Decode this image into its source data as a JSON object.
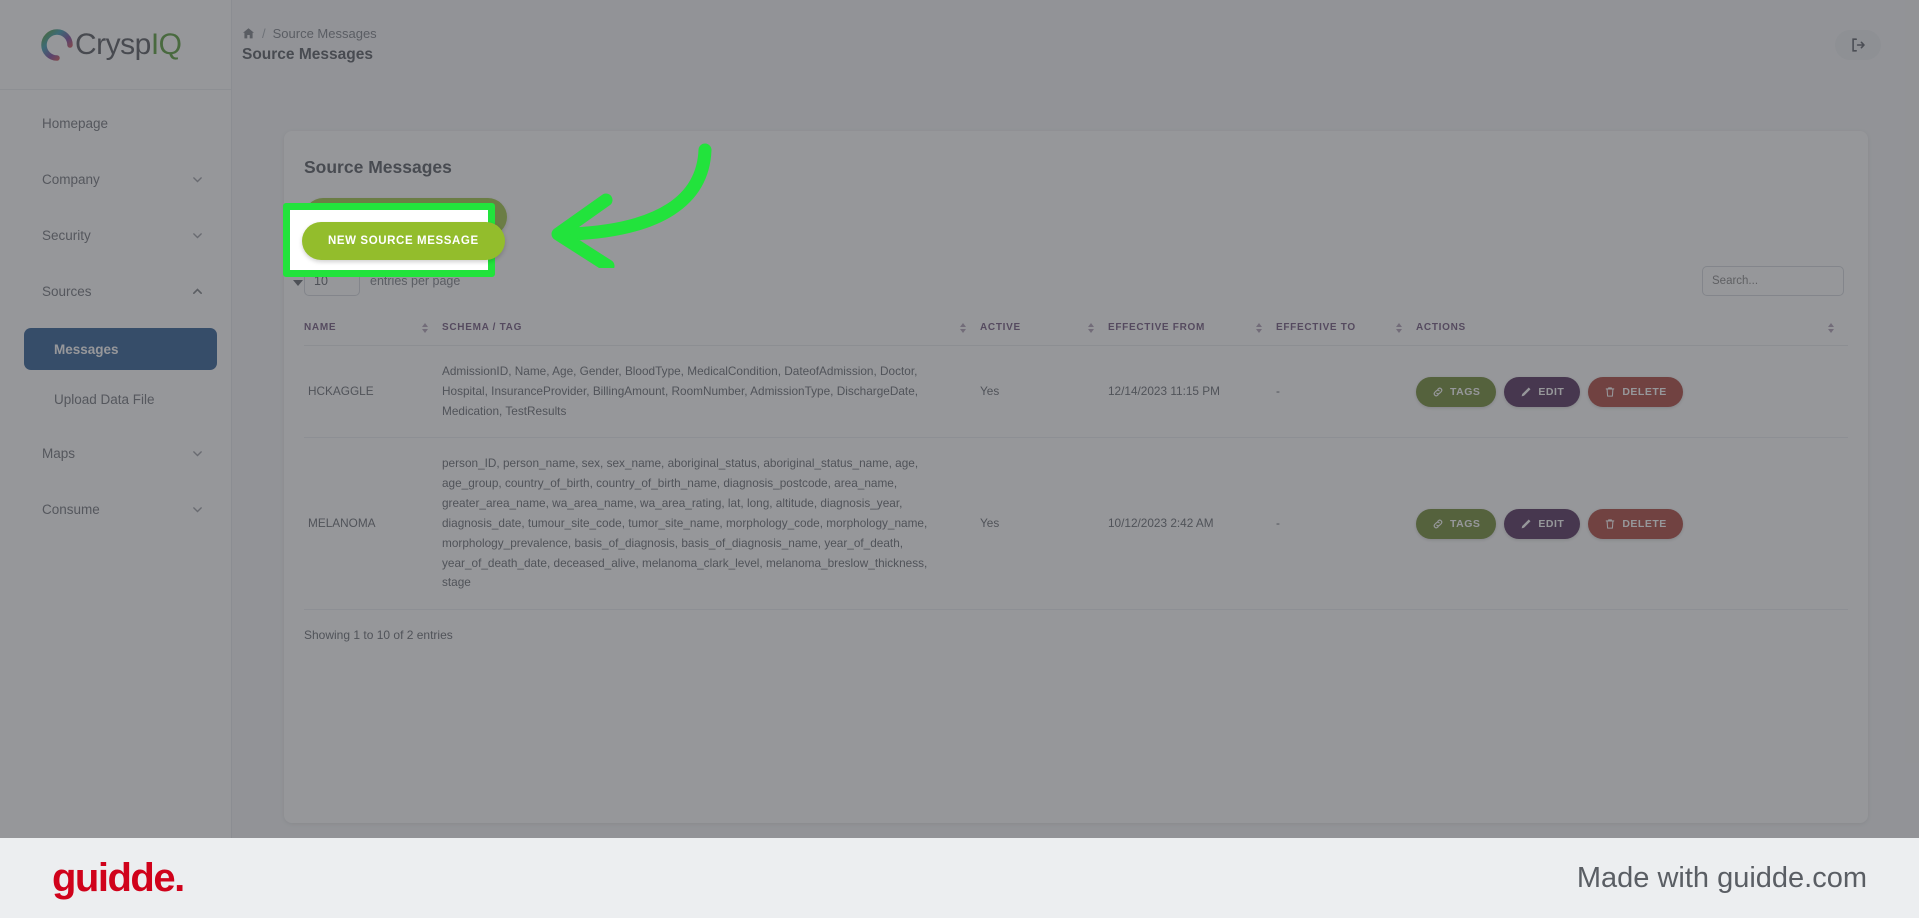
{
  "brand": {
    "logo_text": "Crysp",
    "logo_accent": "IQ",
    "accent_color": "#3f8f1c"
  },
  "sidebar": {
    "items": [
      {
        "label": "Homepage",
        "expandable": false
      },
      {
        "label": "Company",
        "expandable": true,
        "icon": "chevron-down-icon"
      },
      {
        "label": "Security",
        "expandable": true,
        "icon": "chevron-down-icon"
      },
      {
        "label": "Sources",
        "expandable": true,
        "icon": "chevron-up-icon"
      }
    ],
    "sub_items": [
      {
        "label": "Messages",
        "active": true
      },
      {
        "label": "Upload Data File",
        "active": false
      }
    ],
    "items_after": [
      {
        "label": "Maps",
        "expandable": true,
        "icon": "chevron-down-icon"
      },
      {
        "label": "Consume",
        "expandable": true,
        "icon": "chevron-down-icon"
      }
    ],
    "active_color": "#114685"
  },
  "header": {
    "breadcrumb_home": "home-icon",
    "breadcrumb_sep": "/",
    "breadcrumb_current": "Source Messages",
    "page_title": "Source Messages",
    "logout_icon": "logout-icon"
  },
  "card": {
    "title": "Source Messages",
    "new_button_label": "NEW SOURCE MESSAGE",
    "new_button_color": "#93bd2c"
  },
  "controls": {
    "per_page_value": "10",
    "per_page_label": "entries per page",
    "search_placeholder": "Search...",
    "search_value": ""
  },
  "table": {
    "columns": [
      {
        "label": "NAME",
        "sortable": true
      },
      {
        "label": "SCHEMA / TAG",
        "sortable": true
      },
      {
        "label": "ACTIVE",
        "sortable": true
      },
      {
        "label": "EFFECTIVE FROM",
        "sortable": true
      },
      {
        "label": "EFFECTIVE TO",
        "sortable": true
      },
      {
        "label": "ACTIONS",
        "sortable": true
      }
    ],
    "rows": [
      {
        "name": "HCKAGGLE",
        "schema": "AdmissionID, Name, Age, Gender, BloodType, MedicalCondition, DateofAdmission, Doctor, Hospital, InsuranceProvider, BillingAmount, RoomNumber, AdmissionType, DischargeDate, Medication, TestResults",
        "active": "Yes",
        "effective_from": "12/14/2023 11:15 PM",
        "effective_to": "-"
      },
      {
        "name": "MELANOMA",
        "schema": "person_ID, person_name, sex, sex_name, aboriginal_status, aboriginal_status_name, age, age_group, country_of_birth, country_of_birth_name, diagnosis_postcode, area_name, greater_area_name, wa_area_name, wa_area_rating, lat, long, altitude, diagnosis_year, diagnosis_date, tumour_site_code, tumor_site_name, morphology_code, morphology_name, morphology_prevalence, basis_of_diagnosis, basis_of_diagnosis_name, year_of_death, year_of_death_date, deceased_alive, melanoma_clark_level, melanoma_breslow_thickness, stage",
        "active": "Yes",
        "effective_from": "10/12/2023 2:42 AM",
        "effective_to": "-"
      }
    ],
    "actions": {
      "tags_label": "TAGS",
      "edit_label": "EDIT",
      "delete_label": "DELETE",
      "tags_color": "#5d7a18",
      "edit_color": "#3a1144",
      "delete_color": "#a32b22",
      "tags_icon": "link-icon",
      "edit_icon": "pencil-icon",
      "delete_icon": "trash-icon"
    },
    "footer_text": "Showing 1 to 10 of 2 entries"
  },
  "annotation": {
    "highlight_target": "NEW SOURCE MESSAGE",
    "highlight_color": "#22e33c",
    "arrow_icon": "curved-arrow-left-icon"
  },
  "guidde": {
    "logo": "guidde.",
    "made_with": "Made with guidde.com",
    "logo_color": "#d0021b"
  }
}
